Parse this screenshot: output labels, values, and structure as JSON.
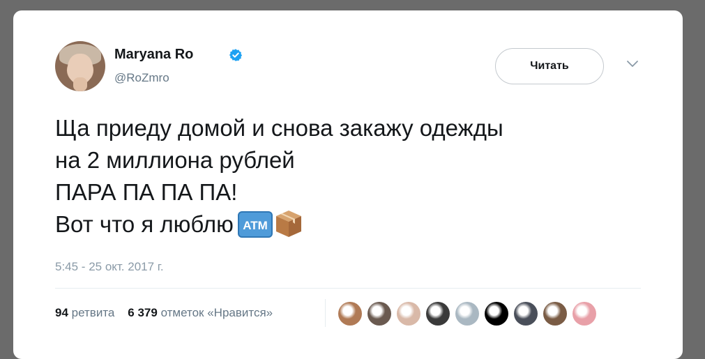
{
  "author": {
    "name": "Maryana Ro",
    "handle": "@RoZmro",
    "verified": true
  },
  "follow_button": {
    "label": "Читать"
  },
  "tweet": {
    "lines": [
      "Ща приеду домой и снова закажу одежды",
      "на 2 миллиона рублей",
      "ПАРА ПА ПА ПА!",
      "Вот что я люблю"
    ],
    "emojis": [
      "atm-sign",
      "package"
    ],
    "atm_label": "ATM",
    "timestamp": "5:45 - 25 окт. 2017 г."
  },
  "stats": {
    "retweets_count": "94",
    "retweets_label": "ретвита",
    "likes_count": "6 379",
    "likes_label": "отметок «Нравится»"
  },
  "likers": [
    {
      "color": "#b07a55"
    },
    {
      "color": "#6a5a50"
    },
    {
      "color": "#d9b9a8"
    },
    {
      "color": "#3a3a3a"
    },
    {
      "color": "#aab8c2"
    },
    {
      "color": "#000000"
    },
    {
      "color": "#4a4f5a"
    },
    {
      "color": "#7a5c45"
    },
    {
      "color": "#e8a0a8"
    }
  ],
  "colors": {
    "accent": "#1da1f2",
    "text": "#14171a",
    "secondary": "#657786"
  }
}
